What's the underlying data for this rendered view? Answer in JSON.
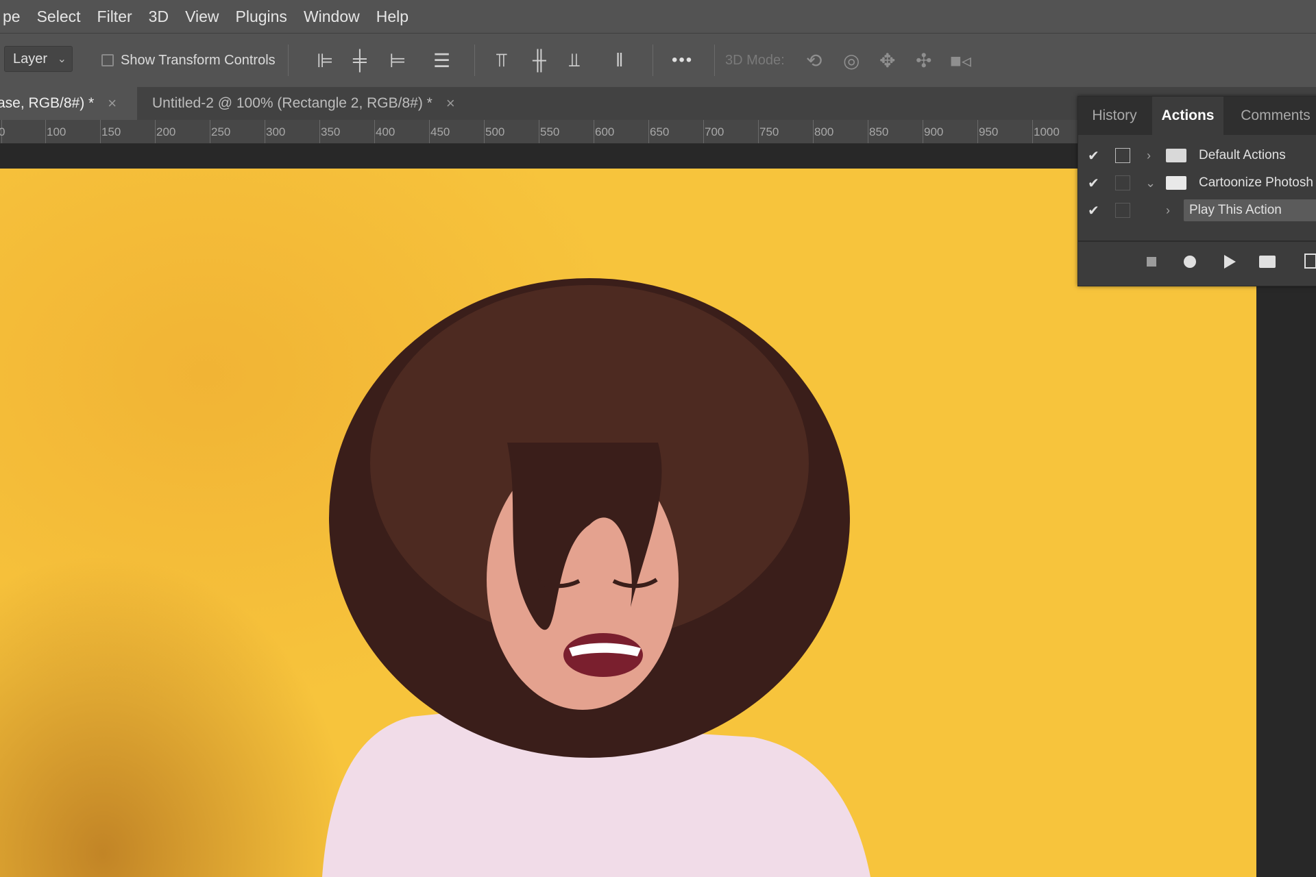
{
  "menu": [
    "pe",
    "Select",
    "Filter",
    "3D",
    "View",
    "Plugins",
    "Window",
    "Help"
  ],
  "options": {
    "layer_select": "Layer",
    "show_transform_controls": "Show Transform Controls",
    "more": "•••",
    "mode_3d": "3D Mode:"
  },
  "tabs": [
    {
      "label": "ase, RGB/8#) *",
      "close": "×"
    },
    {
      "label": "Untitled-2 @ 100% (Rectangle 2, RGB/8#) *",
      "close": "×"
    }
  ],
  "ruler": [
    "0",
    "100",
    "150",
    "200",
    "250",
    "300",
    "350",
    "400",
    "450",
    "500",
    "550",
    "600",
    "650",
    "700",
    "750",
    "800",
    "850",
    "900",
    "950",
    "1000"
  ],
  "panel": {
    "tabs": [
      "History",
      "Actions",
      "Comments"
    ],
    "active_tab": "Actions",
    "rows": [
      {
        "check": "✔",
        "caret": "›",
        "label": "Default Actions"
      },
      {
        "check": "✔",
        "caret": "⌄",
        "label": "Cartoonize Photosh"
      },
      {
        "check": "✔",
        "caret": "›",
        "label": "Play This Action"
      }
    ]
  },
  "canvas": {
    "background_color": "#f7c43c"
  }
}
